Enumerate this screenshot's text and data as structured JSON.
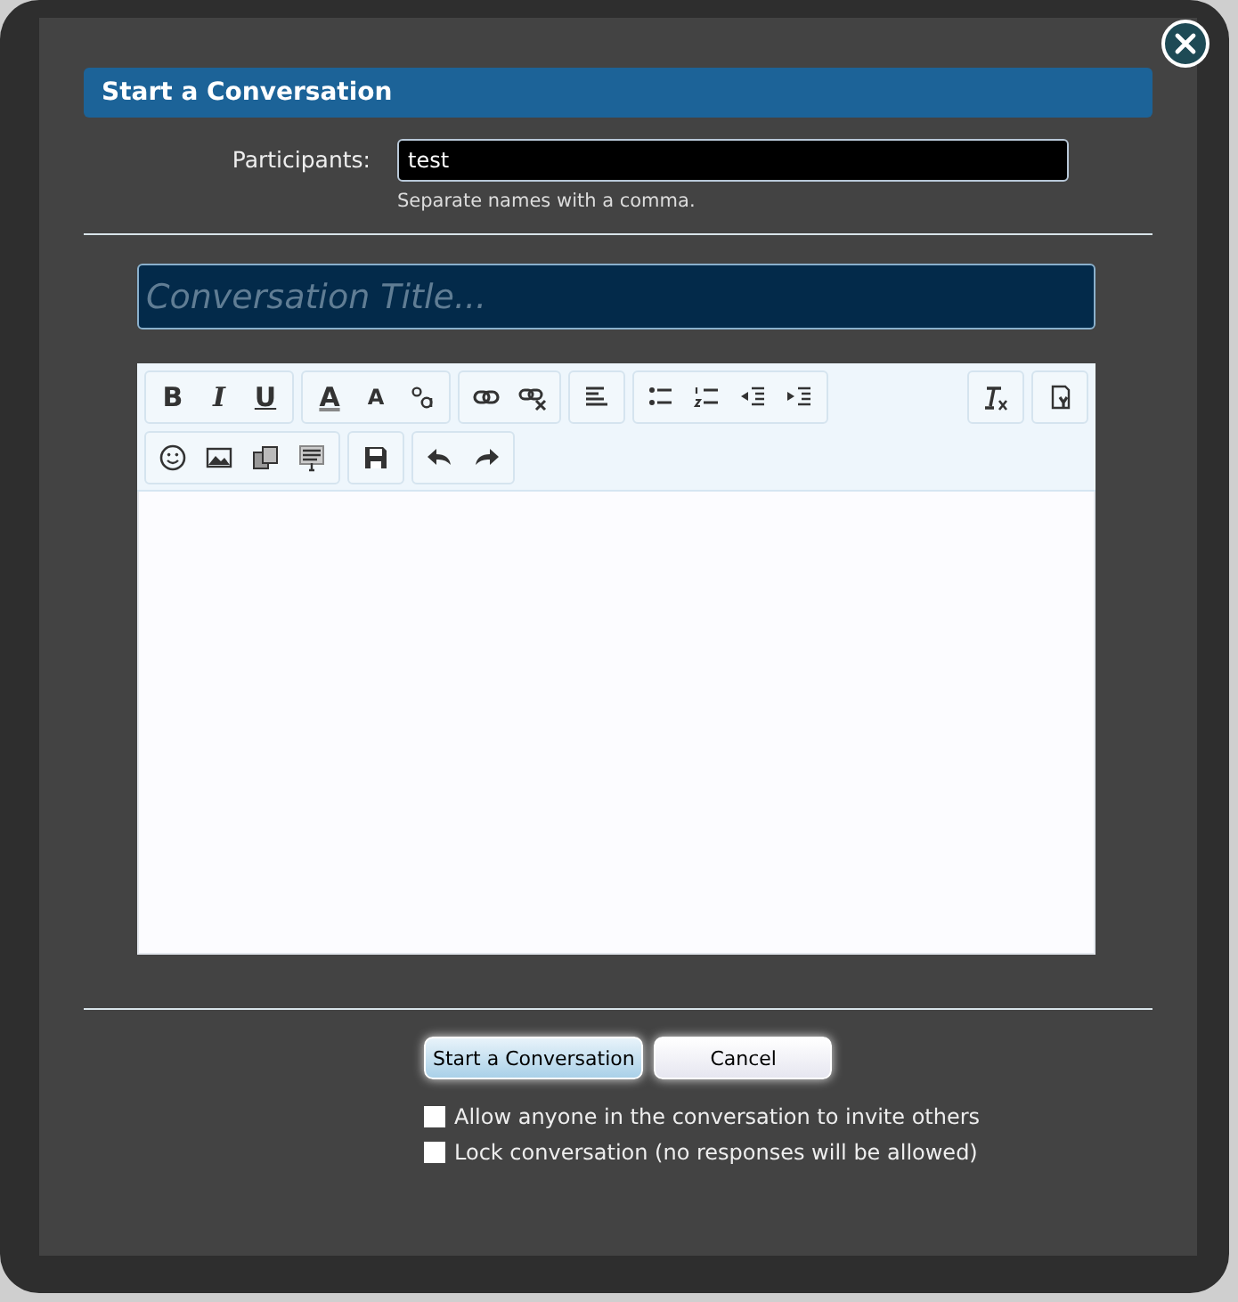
{
  "dialog": {
    "title": "Start a Conversation"
  },
  "participants": {
    "label": "Participants:",
    "value": "test",
    "hint": "Separate names with a comma."
  },
  "title_field": {
    "placeholder": "Conversation Title..."
  },
  "editor_toolbar": {
    "bold": "B",
    "italic": "I",
    "underline": "U",
    "font_color": "A",
    "font_size": "A"
  },
  "buttons": [
    {
      "label": "Start a Conversation",
      "kind": "primary"
    },
    {
      "label": "Cancel",
      "kind": "secondary"
    }
  ],
  "options": [
    {
      "label": "Allow anyone in the conversation to invite others",
      "checked": false
    },
    {
      "label": "Lock conversation (no responses will be allowed)",
      "checked": false
    }
  ]
}
